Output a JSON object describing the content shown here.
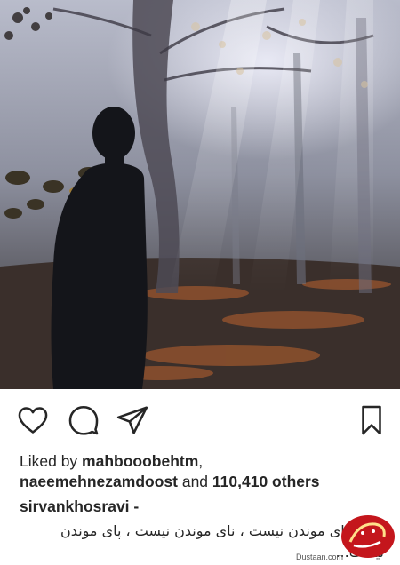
{
  "post": {
    "image_alt": "Silhouette of a man standing in a misty forest with sun rays",
    "liked_by_prefix": "Liked by ",
    "liked_user_1": "mahbooobehtm",
    "liked_sep": ",",
    "liked_user_2": "naeemehnezamdoost",
    "liked_and": " and ",
    "liked_others": "110,410 others",
    "owner": "sirvankhosravi -",
    "caption": "اینجا جای موندن نیست ، نای موندن نیست ، پای موندن نیست..."
  },
  "actions": {
    "like_icon": "heart-icon",
    "comment_icon": "comment-icon",
    "share_icon": "share-icon",
    "save_icon": "bookmark-icon"
  },
  "watermark": {
    "site": "Dustaan.com"
  },
  "colors": {
    "text": "#262626",
    "logo_red": "#c4161c"
  }
}
